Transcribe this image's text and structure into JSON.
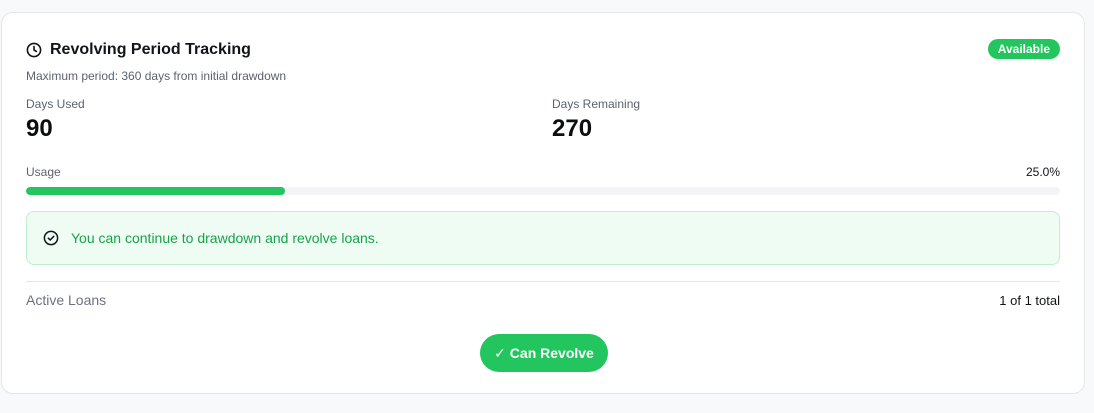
{
  "card": {
    "title": "Revolving Period Tracking",
    "subtitle": "Maximum period: 360 days from initial drawdown",
    "status_badge": "Available",
    "title_icon": "clock-icon"
  },
  "stats": {
    "days_used_label": "Days Used",
    "days_used_value": "90",
    "days_remaining_label": "Days Remaining",
    "days_remaining_value": "270"
  },
  "usage": {
    "label": "Usage",
    "percent_text": "25.0%",
    "fraction": 0.25
  },
  "alert": {
    "icon": "check-circle-icon",
    "message": "You can continue to drawdown and revolve loans."
  },
  "loans": {
    "label": "Active Loans",
    "value": "1 of 1 total"
  },
  "action": {
    "button_label": "✓ Can Revolve"
  },
  "colors": {
    "accent_green": "#22c55e",
    "alert_text_green": "#16a34a",
    "alert_bg": "#effcf3"
  }
}
